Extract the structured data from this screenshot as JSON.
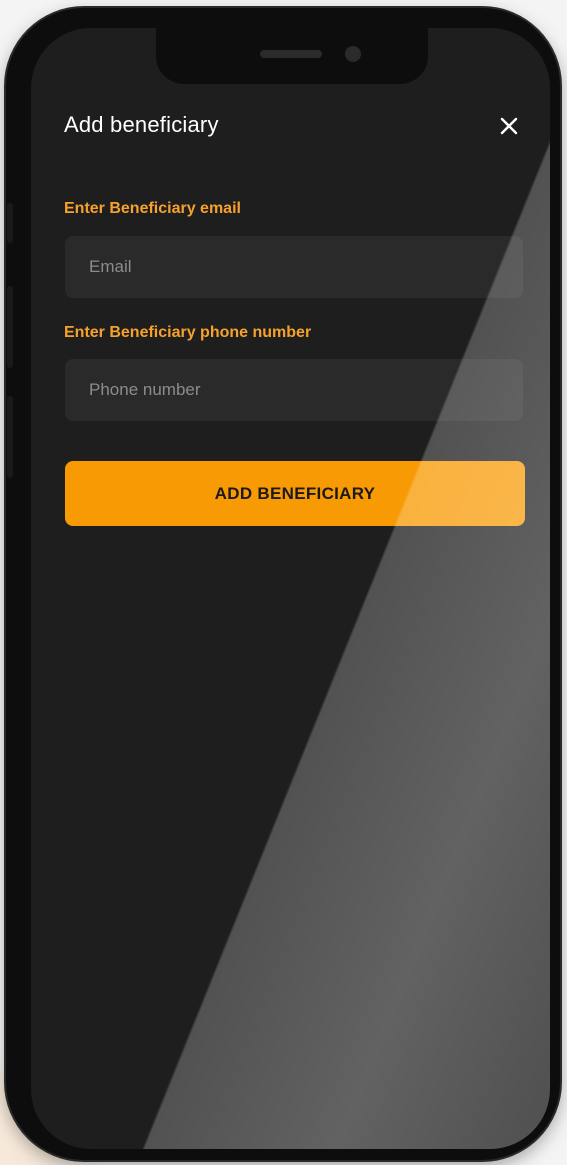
{
  "header": {
    "title": "Add beneficiary",
    "close_icon": "close-icon"
  },
  "form": {
    "email_label": "Enter Beneficiary email",
    "email_placeholder": "Email",
    "email_value": "",
    "phone_label": "Enter Beneficiary phone number",
    "phone_placeholder": "Phone number",
    "phone_value": "",
    "submit_label": "ADD BENEFICIARY"
  },
  "colors": {
    "accent": "#f89a04",
    "label": "#f6a12d",
    "screen_background": "#1e1e1e",
    "field_background": "#2a2a2a",
    "title_text": "#ffffff",
    "placeholder_text": "#8c8c8c"
  }
}
